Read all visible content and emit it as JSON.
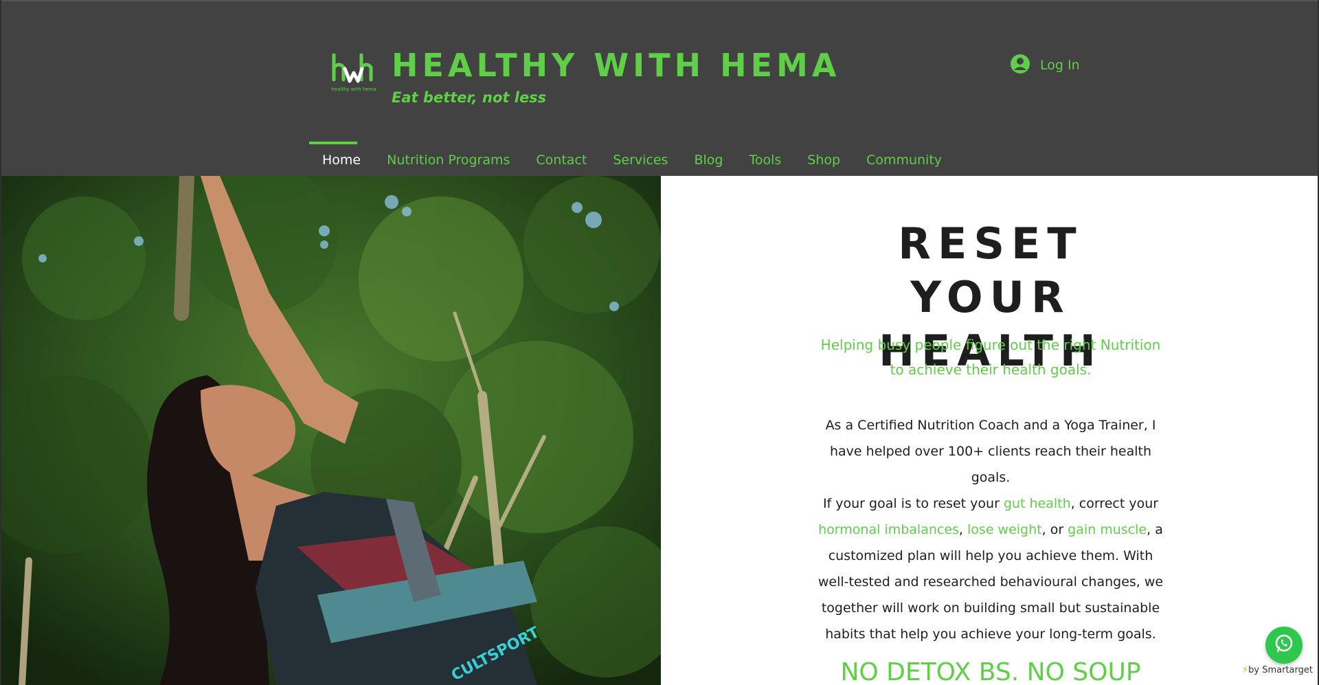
{
  "brand": {
    "logo_text": "healthy with hema",
    "title": "HEALTHY WITH HEMA",
    "tagline": "Eat better, not less",
    "accent_color": "#5fcf47",
    "header_bg": "#424242"
  },
  "header": {
    "login_label": "Log In",
    "login_icon": "user-avatar-icon"
  },
  "nav": {
    "items": [
      {
        "label": "Home",
        "active": true
      },
      {
        "label": "Nutrition Programs",
        "active": false
      },
      {
        "label": "Contact",
        "active": false
      },
      {
        "label": "Services",
        "active": false
      },
      {
        "label": "Blog",
        "active": false
      },
      {
        "label": "Tools",
        "active": false
      },
      {
        "label": "Shop",
        "active": false
      },
      {
        "label": "Community",
        "active": false
      }
    ]
  },
  "hero": {
    "shirt_text": "CULTSPORT"
  },
  "main": {
    "headline": "RESET YOUR HEALTH",
    "subtitle": "Helping busy people figure out the right Nutrition to achieve their health goals.",
    "para1": "As a Certified Nutrition Coach and a Yoga Trainer, I have helped over 100+ clients reach their health goals.",
    "para2_prefix": "If your goal is to reset your ",
    "link_gut_health": "gut health",
    "para2_mid1": ", correct your ",
    "link_hormonal": "hormonal imbalances",
    "para2_sep1": ", ",
    "link_lose_weight": "lose weight",
    "para2_sep2": ", or ",
    "link_gain_muscle": "gain muscle",
    "para2_suffix": ", a customized plan will help you achieve them.  With well-tested and researched behavioural changes, we together will work on building small but sustainable habits that help you achieve your long-term goals.",
    "bottom_line": "NO DETOX BS. NO SOUP"
  },
  "widgets": {
    "whatsapp_icon": "whatsapp-icon",
    "smartarget_label": "by Smartarget"
  }
}
